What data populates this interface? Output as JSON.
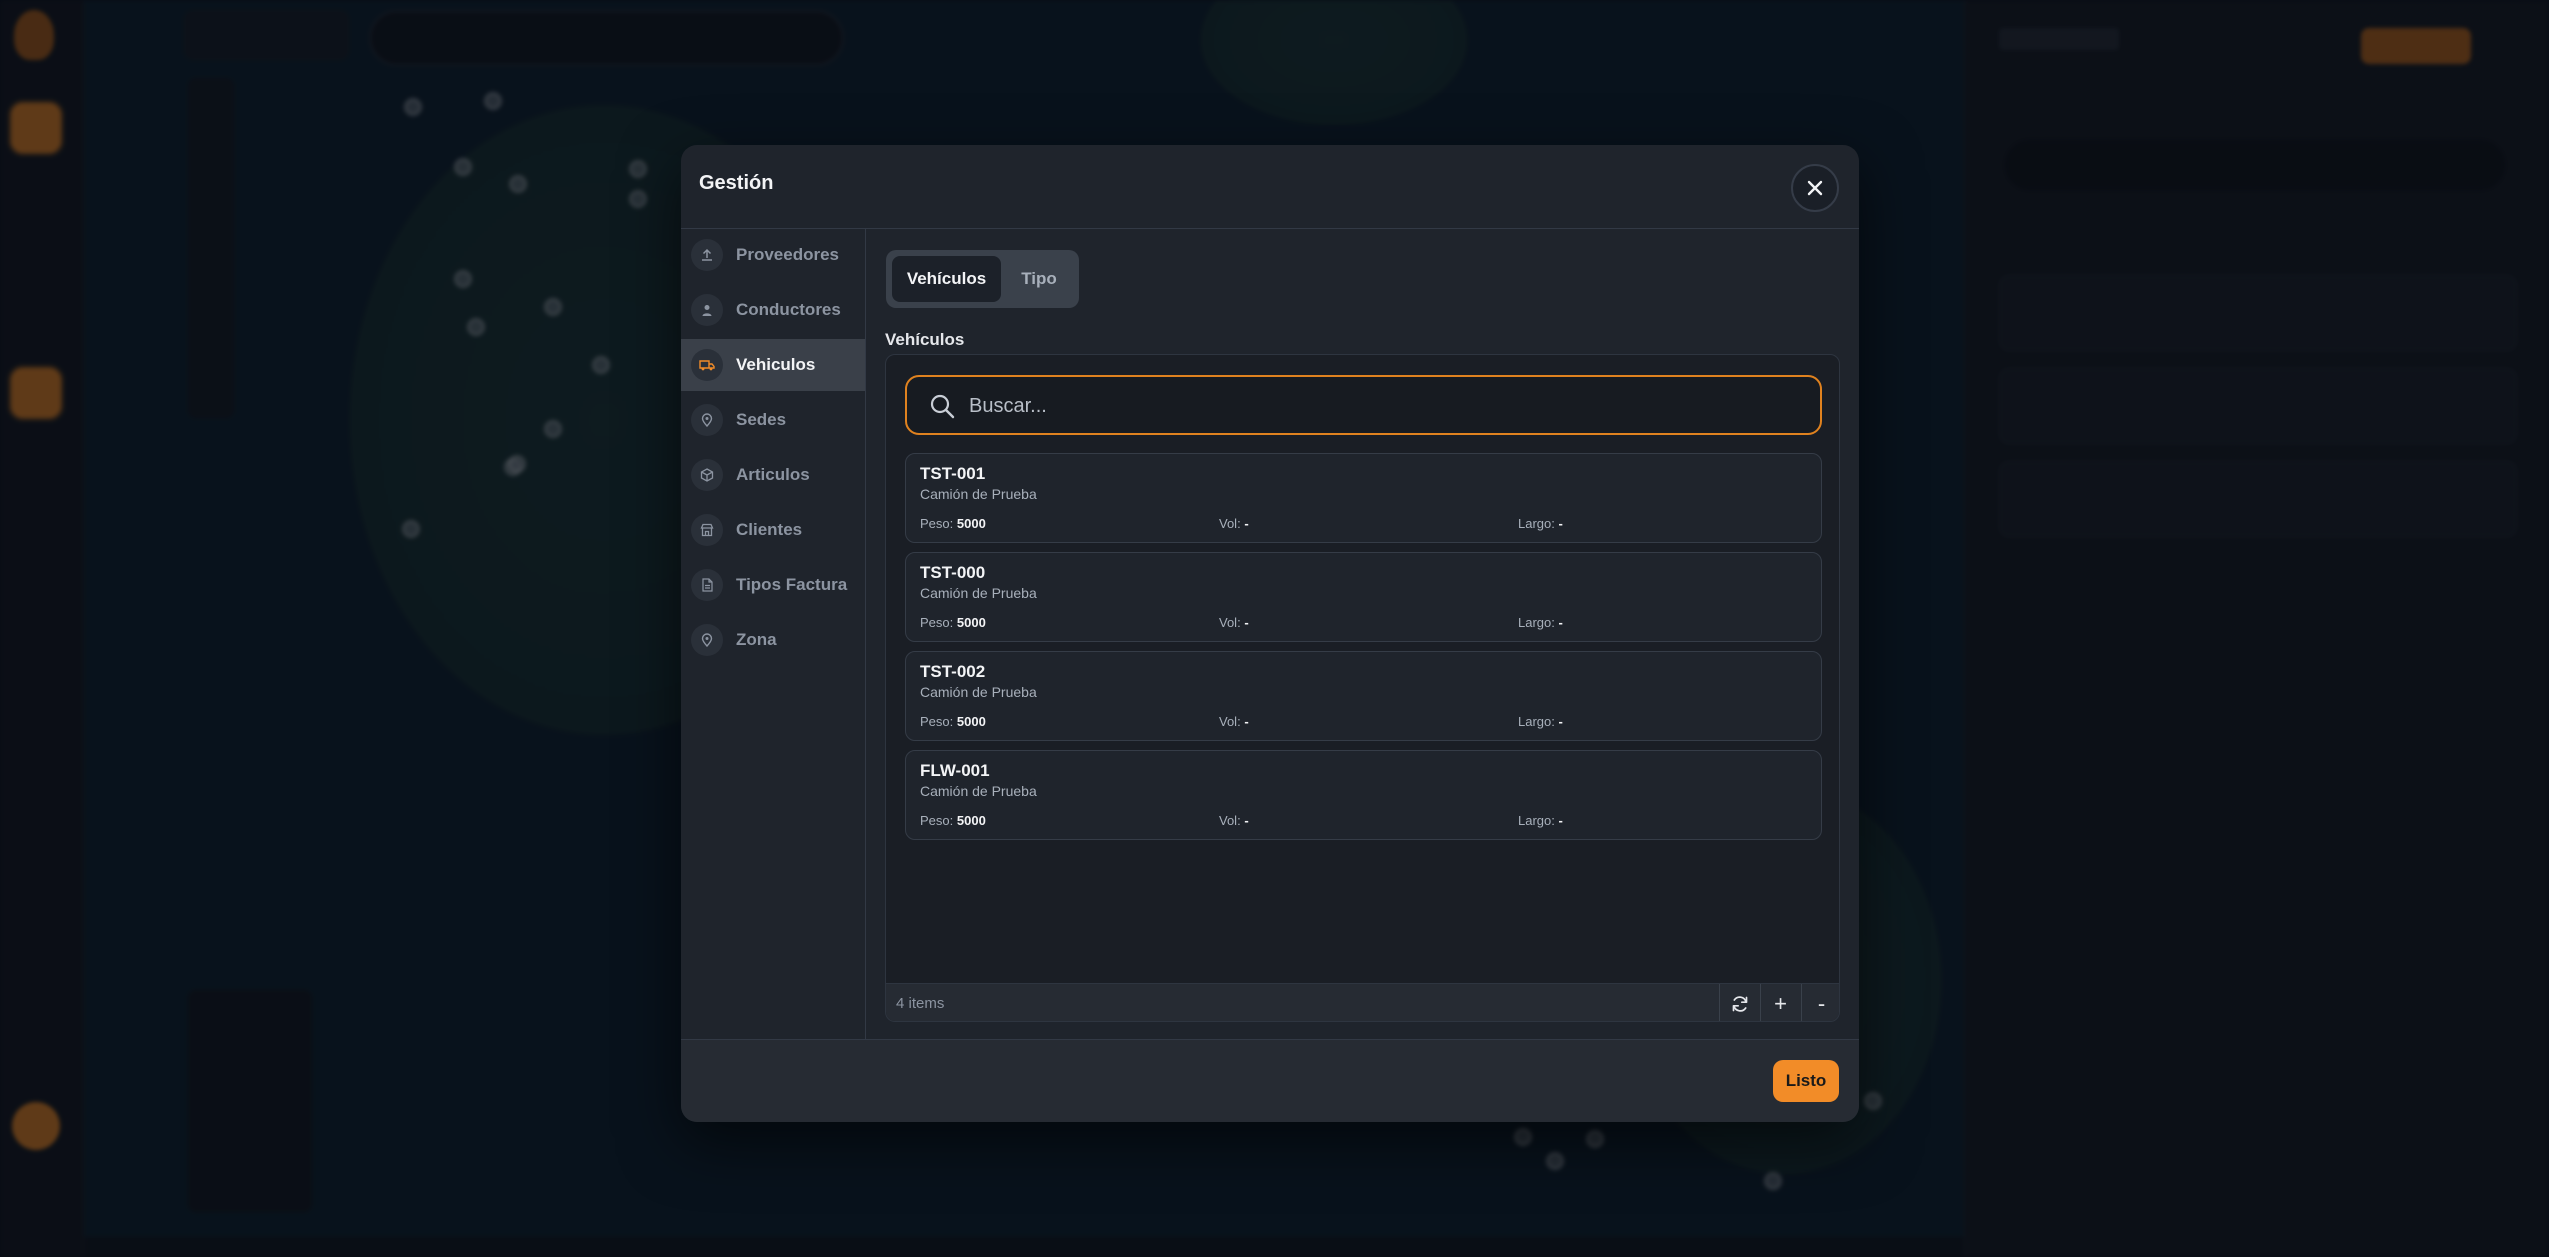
{
  "modal": {
    "title": "Gestión",
    "done_label": "Listo"
  },
  "sidebar": {
    "items": [
      {
        "label": "Proveedores",
        "icon": "upload-icon"
      },
      {
        "label": "Conductores",
        "icon": "user-icon"
      },
      {
        "label": "Vehiculos",
        "icon": "truck-icon",
        "active": true
      },
      {
        "label": "Sedes",
        "icon": "location-pin-icon"
      },
      {
        "label": "Articulos",
        "icon": "box-icon"
      },
      {
        "label": "Clientes",
        "icon": "store-icon"
      },
      {
        "label": "Tipos Factura",
        "icon": "document-icon"
      },
      {
        "label": "Zona",
        "icon": "location-pin-icon"
      }
    ]
  },
  "tabs": {
    "vehiculos": "Vehículos",
    "tipo": "Tipo"
  },
  "section_title": "Vehículos",
  "search": {
    "placeholder": "Buscar..."
  },
  "labels": {
    "peso": "Peso:",
    "vol": "Vol:",
    "largo": "Largo:"
  },
  "vehicles": [
    {
      "code": "TST-001",
      "type": "Camión de Prueba",
      "peso": "5000",
      "vol": "-",
      "largo": "-"
    },
    {
      "code": "TST-000",
      "type": "Camión de Prueba",
      "peso": "5000",
      "vol": "-",
      "largo": "-"
    },
    {
      "code": "TST-002",
      "type": "Camión de Prueba",
      "peso": "5000",
      "vol": "-",
      "largo": "-"
    },
    {
      "code": "FLW-001",
      "type": "Camión de Prueba",
      "peso": "5000",
      "vol": "-",
      "largo": "-"
    }
  ],
  "footer": {
    "items_count": "4 items",
    "add_symbol": "+",
    "remove_symbol": "-"
  },
  "colors": {
    "accent": "#f28c28",
    "modal_bg": "#1f242c",
    "active_item_bg": "#3a4049"
  }
}
